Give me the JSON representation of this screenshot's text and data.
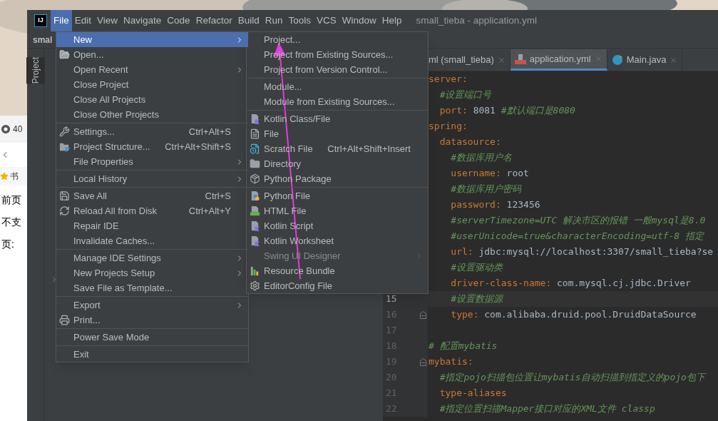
{
  "browser": {
    "tab_text": "40",
    "bookmark": "书",
    "lines": [
      {
        "text": "前页",
        "kind": "plain"
      },
      {
        "text": "不支",
        "kind": "plain"
      },
      {
        "text": "页:",
        "kind": "plain"
      }
    ]
  },
  "ide": {
    "logo": "IJ",
    "menubar": [
      {
        "label": "File",
        "selected": true
      },
      {
        "label": "Edit",
        "selected": false
      },
      {
        "label": "View",
        "selected": false
      },
      {
        "label": "Navigate",
        "selected": false
      },
      {
        "label": "Code",
        "selected": false
      },
      {
        "label": "Refactor",
        "selected": false
      },
      {
        "label": "Build",
        "selected": false
      },
      {
        "label": "Run",
        "selected": false
      },
      {
        "label": "Tools",
        "selected": false
      },
      {
        "label": "VCS",
        "selected": false
      },
      {
        "label": "Window",
        "selected": false
      },
      {
        "label": "Help",
        "selected": false
      }
    ],
    "title": "small_tieba - application.yml",
    "project_name": "smal",
    "tool_window": "Project",
    "tabs": [
      {
        "label": "ml (small_tieba)",
        "selected": false,
        "kind": "plain"
      },
      {
        "label": "application.yml",
        "selected": true,
        "kind": "yaml"
      },
      {
        "label": "Main.java",
        "selected": false,
        "kind": "class"
      }
    ],
    "code": [
      {
        "tokens": [
          {
            "kind": "key",
            "text": "server"
          },
          {
            "kind": "punct",
            "text": ":"
          }
        ]
      },
      {
        "tokens": [
          {
            "kind": "comment",
            "text": "  #设置端口号"
          }
        ]
      },
      {
        "tokens": [
          {
            "kind": "key",
            "text": "  port"
          },
          {
            "kind": "punct",
            "text": ": "
          },
          {
            "kind": "value",
            "text": "8081 "
          },
          {
            "kind": "comment",
            "text": "#默认端口是8080"
          }
        ]
      },
      {
        "tokens": [
          {
            "kind": "key",
            "text": "spring"
          },
          {
            "kind": "punct",
            "text": ":"
          }
        ]
      },
      {
        "tokens": [
          {
            "kind": "key",
            "text": "  datasource"
          },
          {
            "kind": "punct",
            "text": ":"
          }
        ]
      },
      {
        "tokens": [
          {
            "kind": "comment",
            "text": "    #数据库用户名"
          }
        ]
      },
      {
        "tokens": [
          {
            "kind": "key",
            "text": "    username"
          },
          {
            "kind": "punct",
            "text": ": "
          },
          {
            "kind": "value",
            "text": "root"
          }
        ]
      },
      {
        "tokens": [
          {
            "kind": "comment",
            "text": "    #数据库用户密码"
          }
        ]
      },
      {
        "tokens": [
          {
            "kind": "key",
            "text": "    password"
          },
          {
            "kind": "punct",
            "text": ": "
          },
          {
            "kind": "value",
            "text": "123456"
          }
        ]
      },
      {
        "tokens": [
          {
            "kind": "comment",
            "text": "    #serverTimezone=UTC 解决市区的报错 一般mysql是8.0"
          }
        ]
      },
      {
        "tokens": [
          {
            "kind": "comment",
            "text": "    #userUnicode=true&characterEncoding=utf-8 指定"
          }
        ]
      },
      {
        "tokens": [
          {
            "kind": "key",
            "text": "    url"
          },
          {
            "kind": "punct",
            "text": ": "
          },
          {
            "kind": "value",
            "text": "jdbc:mysql://localhost:3307/small_tieba?se"
          }
        ]
      },
      {
        "tokens": [
          {
            "kind": "comment",
            "text": "    #设置驱动类"
          }
        ]
      },
      {
        "tokens": [
          {
            "kind": "key",
            "text": "    driver-class-name"
          },
          {
            "kind": "punct",
            "text": ": "
          },
          {
            "kind": "value",
            "text": "com.mysql.cj.jdbc.Driver"
          }
        ]
      },
      {
        "number": "15",
        "current": true,
        "tokens": [
          {
            "kind": "comment",
            "text": "    #设置数据源"
          }
        ]
      },
      {
        "number": "16",
        "current": false,
        "fold": true,
        "tokens": [
          {
            "kind": "key",
            "text": "    type"
          },
          {
            "kind": "punct",
            "text": ": "
          },
          {
            "kind": "value",
            "text": "com.alibaba.druid.pool.DruidDataSource"
          }
        ]
      },
      {
        "number": "17",
        "current": false
      },
      {
        "number": "18",
        "current": false,
        "tokens": [
          {
            "kind": "comment",
            "text": "# 配置mybatis"
          }
        ]
      },
      {
        "number": "19",
        "current": false,
        "fold": true,
        "tokens": [
          {
            "kind": "key",
            "text": "mybatis"
          },
          {
            "kind": "punct",
            "text": ":"
          }
        ]
      },
      {
        "number": "20",
        "current": false,
        "tokens": [
          {
            "kind": "comment",
            "text": "  #指定pojo扫描包位置让mybatis自动扫描到指定义的pojo包下"
          }
        ]
      },
      {
        "number": "21",
        "current": false,
        "tokens": [
          {
            "kind": "key",
            "text": "  type-aliases"
          }
        ]
      },
      {
        "number": "22",
        "current": false,
        "tokens": [
          {
            "kind": "comment",
            "text": "  #指定位置扫描Mapper接口对应的XML文件 classp"
          }
        ]
      }
    ],
    "file_menu": [
      [
        {
          "label": "New",
          "selected": true,
          "submenu": true
        },
        {
          "label": "Open...",
          "kind": "folder-open",
          "selected": false
        },
        {
          "label": "Open Recent",
          "selected": false,
          "submenu": true
        },
        {
          "label": "Close Project",
          "selected": false
        },
        {
          "label": "Close All Projects",
          "selected": false
        },
        {
          "label": "Close Other Projects",
          "selected": false
        }
      ],
      [
        {
          "label": "Settings...",
          "kind": "wrench",
          "shortcut": "Ctrl+Alt+S",
          "selected": false
        },
        {
          "label": "Project Structure...",
          "kind": "structure",
          "shortcut": "Ctrl+Alt+Shift+S",
          "selected": false
        },
        {
          "label": "File Properties",
          "selected": false,
          "submenu": true
        }
      ],
      [
        {
          "label": "Local History",
          "selected": false,
          "submenu": true
        }
      ],
      [
        {
          "label": "Save All",
          "kind": "save",
          "shortcut": "Ctrl+S",
          "selected": false
        },
        {
          "label": "Reload All from Disk",
          "kind": "reload",
          "shortcut": "Ctrl+Alt+Y",
          "selected": false
        },
        {
          "label": "Repair IDE",
          "selected": false
        },
        {
          "label": "Invalidate Caches...",
          "selected": false
        }
      ],
      [
        {
          "label": "Manage IDE Settings",
          "selected": false,
          "submenu": true
        },
        {
          "label": "New Projects Setup",
          "selected": false,
          "submenu": true
        },
        {
          "label": "Save File as Template...",
          "selected": false
        }
      ],
      [
        {
          "label": "Export",
          "selected": false,
          "submenu": true
        },
        {
          "label": "Print...",
          "kind": "print",
          "selected": false
        }
      ],
      [
        {
          "label": "Power Save Mode",
          "selected": false
        }
      ],
      [
        {
          "label": "Exit",
          "selected": false
        }
      ]
    ],
    "new_menu": [
      [
        {
          "label": "Project..."
        },
        {
          "label": "Project from Existing Sources..."
        },
        {
          "label": "Project from Version Control..."
        }
      ],
      [
        {
          "label": "Module..."
        },
        {
          "label": "Module from Existing Sources..."
        }
      ],
      [
        {
          "label": "Kotlin Class/File",
          "kind": "kotlin"
        },
        {
          "label": "File",
          "kind": "file"
        },
        {
          "label": "Scratch File",
          "kind": "scratch",
          "shortcut": "Ctrl+Alt+Shift+Insert"
        },
        {
          "label": "Directory",
          "kind": "folder"
        },
        {
          "label": "Python Package",
          "kind": "package"
        }
      ],
      [
        {
          "label": "Python File",
          "kind": "python"
        },
        {
          "label": "HTML File",
          "kind": "html"
        },
        {
          "label": "Kotlin Script",
          "kind": "kotlin"
        },
        {
          "label": "Kotlin Worksheet",
          "kind": "kotlin"
        },
        {
          "label": "Swing UI Designer",
          "disabled": true,
          "submenu": true
        },
        {
          "label": "Resource Bundle",
          "kind": "bundle"
        },
        {
          "label": "EditorConfig File",
          "kind": "gear"
        }
      ]
    ]
  }
}
